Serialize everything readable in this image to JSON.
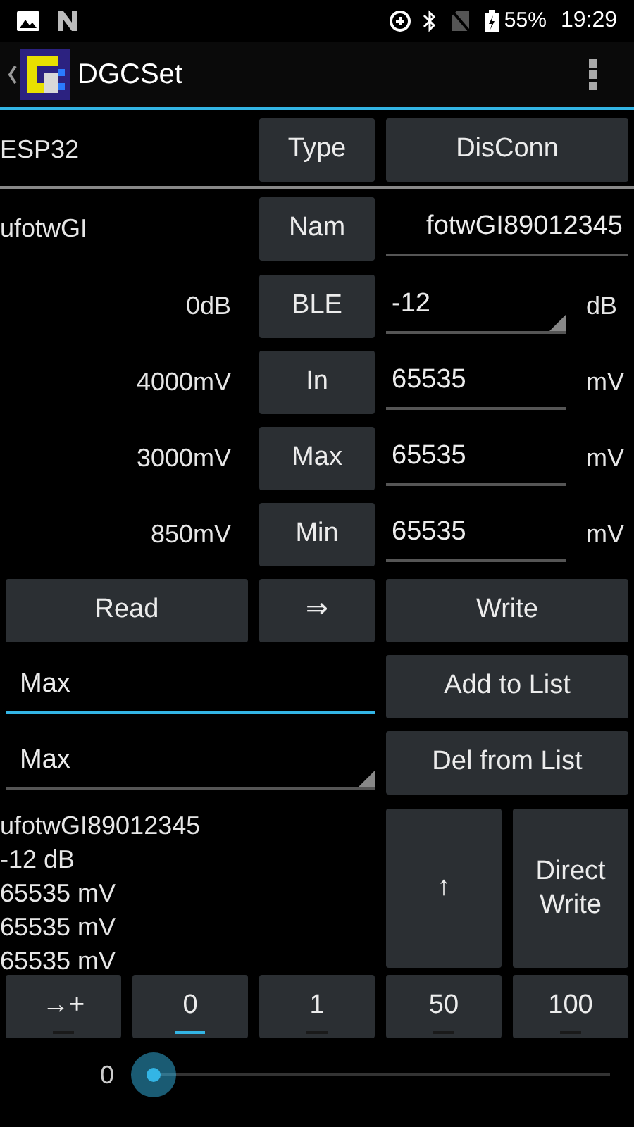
{
  "status_bar": {
    "battery": "55%",
    "time": "19:29"
  },
  "app_bar": {
    "title": "DGCSet"
  },
  "device_row": {
    "label": "ESP32",
    "type_button": "Type",
    "disconnect_button": "DisConn"
  },
  "name_row": {
    "reading": "ufotwGI",
    "button": "Nam",
    "value": "fotwGI89012345"
  },
  "settings": [
    {
      "kind": "spinner",
      "reading": "0dB",
      "button": "BLE",
      "value": "-12",
      "unit": "dB"
    },
    {
      "kind": "input",
      "reading": "4000mV",
      "button": "In",
      "value": "65535",
      "unit": "mV"
    },
    {
      "kind": "input",
      "reading": "3000mV",
      "button": "Max",
      "value": "65535",
      "unit": "mV"
    },
    {
      "kind": "input",
      "reading": "850mV",
      "button": "Min",
      "value": "65535",
      "unit": "mV"
    }
  ],
  "actions": [
    "Read",
    "⇒",
    "Write"
  ],
  "list_input": {
    "value": "Max",
    "focused": true,
    "button": "Add to List"
  },
  "list_spinner": {
    "value": "Max",
    "button": "Del from List"
  },
  "log": [
    "ufotwGI89012345",
    "-12 dB",
    "65535 mV",
    "65535 mV",
    "65535 mV"
  ],
  "up_button": "↑",
  "direct_write_button": "Direct Write",
  "step_buttons": [
    {
      "label": "→+",
      "selected": false
    },
    {
      "label": "0",
      "selected": true
    },
    {
      "label": "1",
      "selected": false
    },
    {
      "label": "50",
      "selected": false
    },
    {
      "label": "100",
      "selected": false
    }
  ],
  "slider": {
    "reading": "0"
  }
}
